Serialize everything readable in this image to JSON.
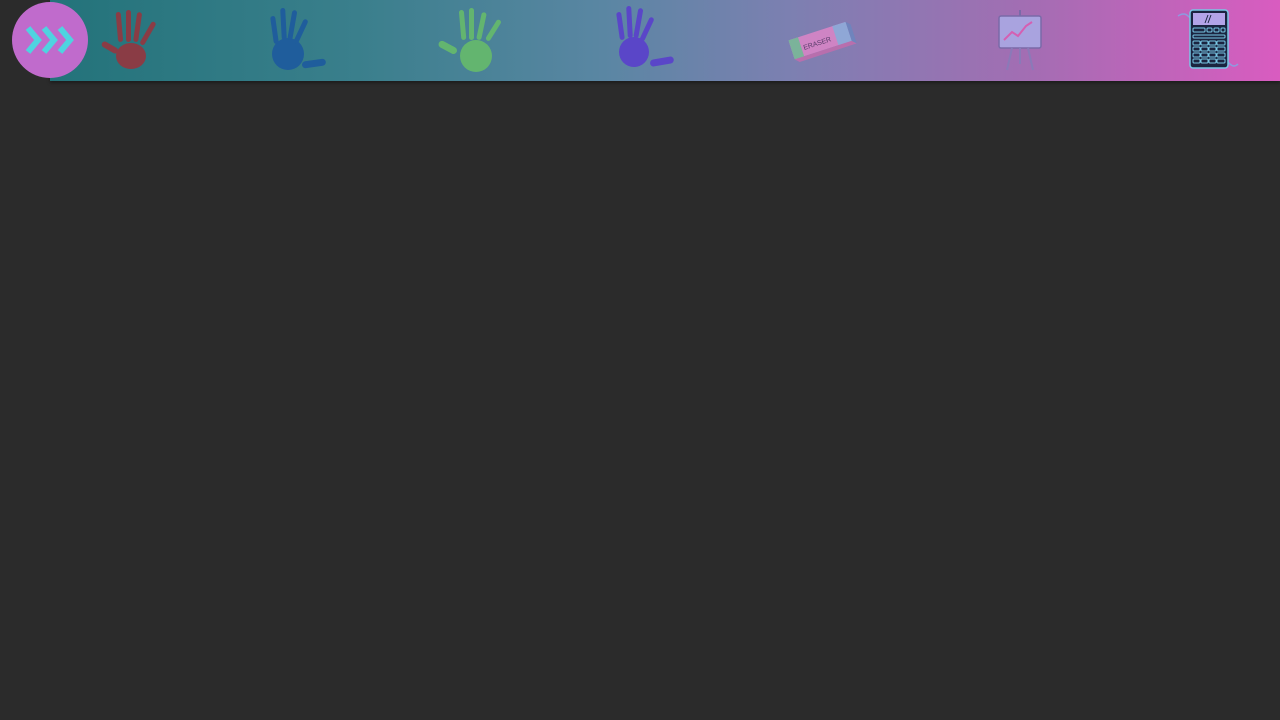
{
  "toolbar": {
    "expand_button_icon": "triple-chevron-right-icon",
    "tools": [
      {
        "name": "red-handprint",
        "icon": "hand-icon",
        "color": "#8a3c45"
      },
      {
        "name": "blue-handprint",
        "icon": "hand-icon",
        "color": "#1f5d9c"
      },
      {
        "name": "green-handprint",
        "icon": "hand-icon",
        "color": "#63b56f"
      },
      {
        "name": "purple-handprint",
        "icon": "hand-icon",
        "color": "#5a46c8"
      },
      {
        "name": "eraser",
        "icon": "eraser-icon",
        "label": "ERASER"
      },
      {
        "name": "chart-easel",
        "icon": "easel-chart-icon"
      },
      {
        "name": "calculator",
        "icon": "calculator-icon"
      }
    ]
  },
  "colors": {
    "background": "#2b2b2b",
    "expand_button": "#c06bcc",
    "chevron": "#4fd3e0"
  }
}
